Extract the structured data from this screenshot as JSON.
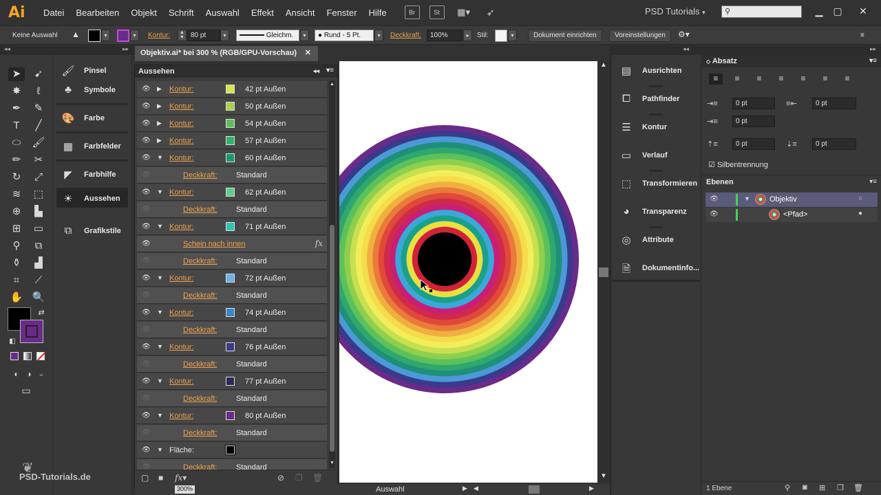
{
  "menubar": {
    "logo": "Ai",
    "items": [
      "Datei",
      "Bearbeiten",
      "Objekt",
      "Schrift",
      "Auswahl",
      "Effekt",
      "Ansicht",
      "Fenster",
      "Hilfe"
    ],
    "bridge_label": "Br",
    "stock_label": "St",
    "workspace": "PSD Tutorials"
  },
  "controlbar": {
    "selection": "Keine Auswahl",
    "kontur_label": "Kontur:",
    "kontur_value": "80 pt",
    "stroke_profile": "Gleichm.",
    "brush": "Rund - 5 Pt.",
    "opacity_label": "Deckkraft:",
    "opacity_value": "100%",
    "style_label": "Stil:",
    "doc_setup_button": "Dokument einrichten",
    "preferences_button": "Voreinstellungen"
  },
  "document_tab": {
    "title": "Objektiv.ai* bei 300 % (RGB/GPU-Vorschau)"
  },
  "left_dock": {
    "items": [
      "Pinsel",
      "Symbole",
      "Farbe",
      "Farbfelder",
      "Farbhilfe",
      "Aussehen",
      "Grafikstile"
    ]
  },
  "appearance": {
    "title": "Aussehen",
    "rows": [
      {
        "kind": "stroke",
        "label": "Kontur:",
        "color": "#d6e64a",
        "value": "42 pt  Außen",
        "expanded": false
      },
      {
        "kind": "stroke",
        "label": "Kontur:",
        "color": "#a8d24e",
        "value": "50 pt  Außen",
        "expanded": false
      },
      {
        "kind": "stroke",
        "label": "Kontur:",
        "color": "#5cc15a",
        "value": "54 pt  Außen",
        "expanded": false
      },
      {
        "kind": "stroke",
        "label": "Kontur:",
        "color": "#2fb36a",
        "value": "57 pt  Außen",
        "expanded": false
      },
      {
        "kind": "stroke",
        "label": "Kontur:",
        "color": "#1a9a6c",
        "value": "60 pt  Außen",
        "expanded": true
      },
      {
        "kind": "sub",
        "label": "Deckkraft:",
        "value": "Standard"
      },
      {
        "kind": "stroke",
        "label": "Kontur:",
        "color": "#5ccf8a",
        "value": "62 pt  Außen",
        "expanded": true
      },
      {
        "kind": "sub",
        "label": "Deckkraft:",
        "value": "Standard"
      },
      {
        "kind": "stroke",
        "label": "Kontur:",
        "color": "#2ec4b0",
        "value": "71 pt  Außen",
        "expanded": true
      },
      {
        "kind": "effect",
        "label": "Schein nach innen",
        "fx": "fx"
      },
      {
        "kind": "sub",
        "label": "Deckkraft:",
        "value": "Standard"
      },
      {
        "kind": "stroke",
        "label": "Kontur:",
        "color": "#6ab4e8",
        "value": "72 pt  Außen",
        "expanded": true
      },
      {
        "kind": "sub",
        "label": "Deckkraft:",
        "value": "Standard"
      },
      {
        "kind": "stroke",
        "label": "Kontur:",
        "color": "#3a86c8",
        "value": "74 pt  Außen",
        "expanded": true
      },
      {
        "kind": "sub",
        "label": "Deckkraft:",
        "value": "Standard"
      },
      {
        "kind": "stroke",
        "label": "Kontur:",
        "color": "#3a3a8a",
        "value": "76 pt  Außen",
        "expanded": true
      },
      {
        "kind": "sub",
        "label": "Deckkraft:",
        "value": "Standard"
      },
      {
        "kind": "stroke",
        "label": "Kontur:",
        "color": "#2a2a58",
        "value": "77 pt  Außen",
        "expanded": true
      },
      {
        "kind": "sub",
        "label": "Deckkraft:",
        "value": "Standard"
      },
      {
        "kind": "stroke",
        "label": "Kontur:",
        "color": "#6a2a8a",
        "value": "80 pt  Außen",
        "expanded": true
      },
      {
        "kind": "sub",
        "label": "Deckkraft:",
        "value": "Standard"
      },
      {
        "kind": "fill",
        "label": "Fläche:",
        "color": "#000000"
      },
      {
        "kind": "sub",
        "label": "Deckkraft:",
        "value": "Standard"
      }
    ]
  },
  "canvas": {
    "rings": [
      "#6a2a8a",
      "#3a3a8a",
      "#4a9ad8",
      "#1f8f7a",
      "#2fa86e",
      "#5cc15a",
      "#8fcf4e",
      "#c8e050",
      "#f2ee5a",
      "#f5dc4a",
      "#f0b040",
      "#ea7a3a",
      "#e0493a",
      "#d02a4a",
      "#c81e78",
      "#3aa8d8",
      "#1aa08a",
      "#e8e040",
      "#d0223a",
      "#000000"
    ]
  },
  "statusbar": {
    "zoom": "300%",
    "tool": "Auswahl"
  },
  "right_dock": {
    "items": [
      "Ausrichten",
      "Pathfinder",
      "Kontur",
      "Verlauf",
      "Transformieren",
      "Transparenz",
      "Attribute",
      "Dokumentinfo..."
    ]
  },
  "paragraph": {
    "title": "Absatz",
    "fields": [
      "0 pt",
      "0 pt",
      "0 pt",
      "0 pt",
      "0 pt"
    ],
    "hyphenation": "Silbentrennung"
  },
  "layers": {
    "title": "Ebenen",
    "items": [
      {
        "name": "Objektiv",
        "color": "#5a5aa0"
      },
      {
        "name": "<Pfad>",
        "color": ""
      }
    ],
    "count": "1 Ebene"
  },
  "watermark": "PSD-Tutorials.de"
}
